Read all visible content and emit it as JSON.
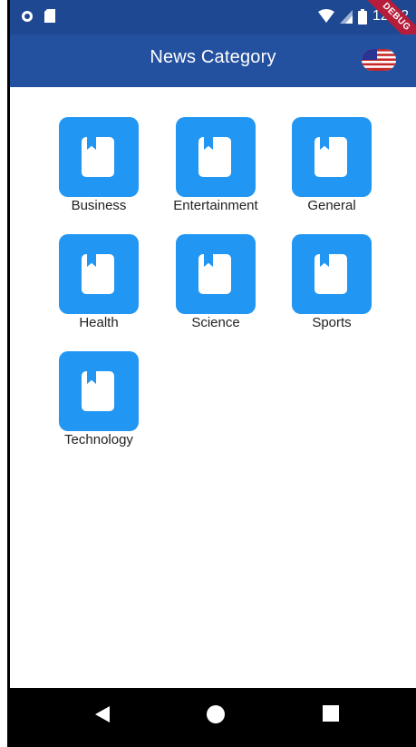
{
  "status_bar": {
    "time": "12:52",
    "debug_label": "DEBUG"
  },
  "app_bar": {
    "title": "News Category"
  },
  "categories": [
    {
      "label": "Business"
    },
    {
      "label": "Entertainment"
    },
    {
      "label": "General"
    },
    {
      "label": "Health"
    },
    {
      "label": "Science"
    },
    {
      "label": "Sports"
    },
    {
      "label": "Technology"
    }
  ],
  "colors": {
    "status_bar": "#1f4892",
    "app_bar": "#23509f",
    "tile": "#2196f3",
    "debug_banner": "#b71c3a"
  },
  "icons": {
    "tile": "bookmark-book-icon",
    "locale": "us-flag-icon",
    "nav": [
      "back-triangle-icon",
      "home-circle-icon",
      "recents-square-icon"
    ]
  }
}
